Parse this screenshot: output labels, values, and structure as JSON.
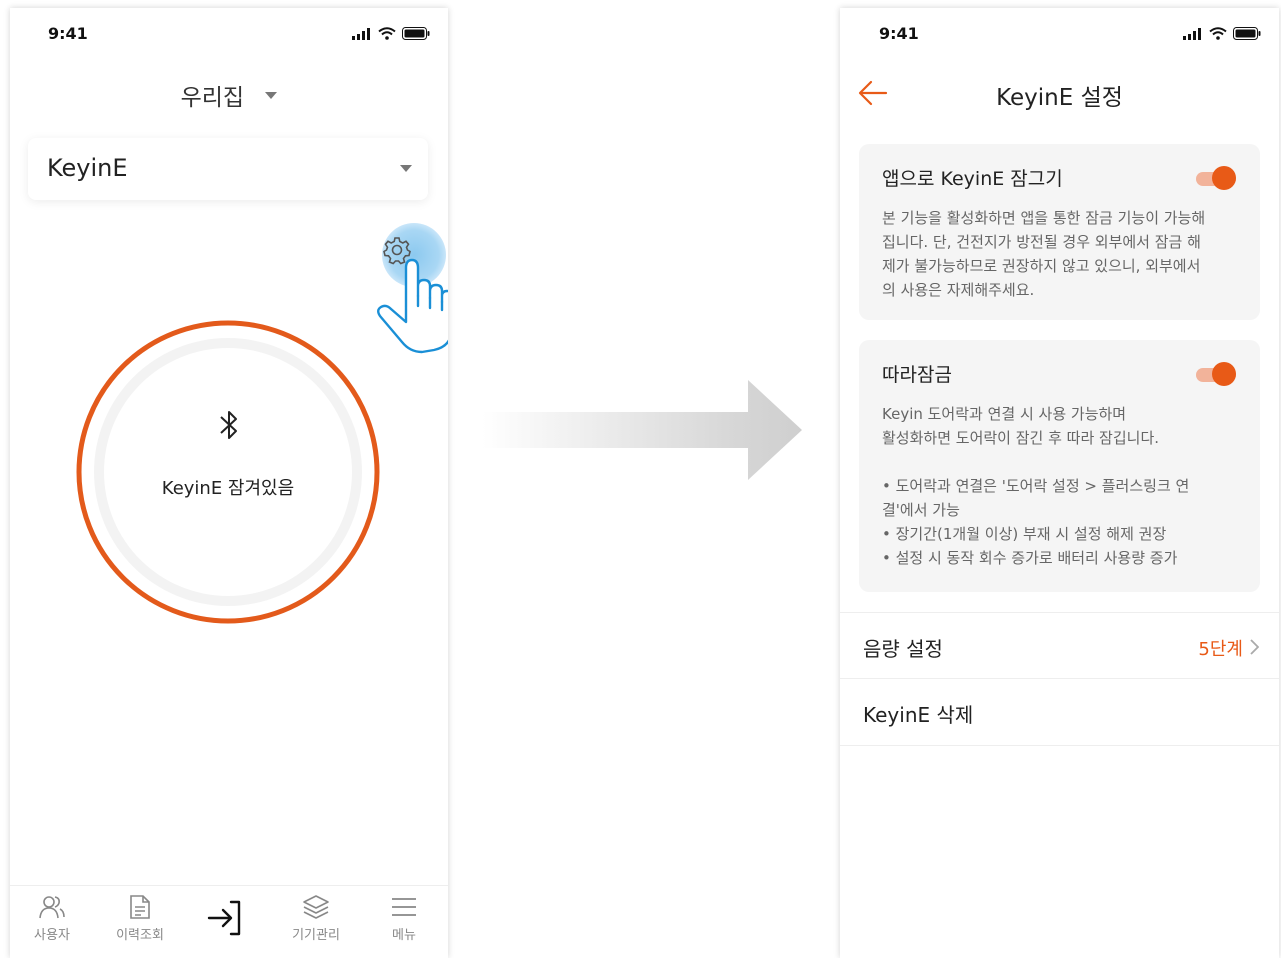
{
  "left_screen": {
    "status_time": "9:41",
    "home_title": "우리집",
    "device_name": "KeyinE",
    "lock_status": "KeyinE 잠겨있음",
    "tabs": [
      {
        "label": "사용자",
        "icon": "users-icon"
      },
      {
        "label": "이력조회",
        "icon": "document-icon"
      },
      {
        "label": "",
        "icon": "enter-icon"
      },
      {
        "label": "기기관리",
        "icon": "layers-icon"
      },
      {
        "label": "메뉴",
        "icon": "menu-icon"
      }
    ]
  },
  "right_screen": {
    "status_time": "9:41",
    "title": "KeyinE 설정",
    "app_lock": {
      "title": "앱으로 KeyinE 잠그기",
      "description": "본 기능을 활성화하면 앱을 통한 잠금 기능이 가능해\n집니다. 단, 건전지가 방전될 경우 외부에서 잠금 해\n제가 불가능하므로 권장하지 않고 있으니, 외부에서\n의 사용은 자제해주세요.",
      "enabled": true
    },
    "follow_lock": {
      "title": "따라잠금",
      "description": "Keyin 도어락과 연결 시 사용 가능하며\n활성화하면 도어락이 잠긴 후 따라 잠깁니다.\n\n • 도어락과 연결은 '도어락 설정 > 플러스링크 연\n결'에서 가능\n • 장기간(1개월 이상) 부재 시 설정 해제 권장\n • 설정 시 동작 회수 증가로 배터리 사용량 증가",
      "enabled": true
    },
    "volume": {
      "label": "음량 설정",
      "value": "5단계"
    },
    "delete_label": "KeyinE 삭제"
  },
  "colors": {
    "accent": "#e85a17",
    "toggle_track": "#f2b39a",
    "card_bg": "#f5f5f5",
    "touch_highlight": "#8cc9ef",
    "hand_stroke": "#1a8fd6"
  }
}
